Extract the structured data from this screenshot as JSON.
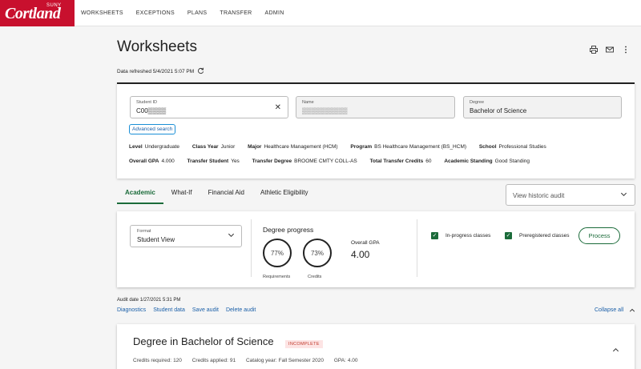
{
  "brand": {
    "suny": "SUNY",
    "name": "Cortland"
  },
  "nav": [
    "WORKSHEETS",
    "EXCEPTIONS",
    "PLANS",
    "TRANSFER",
    "ADMIN"
  ],
  "page_title": "Worksheets",
  "icons": {
    "print": "print-icon",
    "mail": "mail-icon",
    "more": "more-vertical-icon",
    "refresh": "refresh-icon"
  },
  "refresh_text": "Data refreshed 5/4/2021 5:07 PM",
  "student": {
    "id_label": "Student ID",
    "id_value": "C00▒▒▒▒",
    "name_label": "Name",
    "name_value": "▒▒▒▒▒▒▒▒▒▒",
    "degree_label": "Degree",
    "degree_value": "Bachelor of Science",
    "advanced_search": "Advanced search",
    "row1": [
      {
        "k": "Level",
        "v": "Undergraduate"
      },
      {
        "k": "Class Year",
        "v": "Junior"
      },
      {
        "k": "Major",
        "v": "Healthcare Management (HCM)"
      },
      {
        "k": "Program",
        "v": "BS Healthcare Management (BS_HCM)"
      },
      {
        "k": "School",
        "v": "Professional Studies"
      }
    ],
    "row2": [
      {
        "k": "Overall GPA",
        "v": "4.000"
      },
      {
        "k": "Transfer Student",
        "v": "Yes"
      },
      {
        "k": "Transfer Degree",
        "v": "BROOME CMTY COLL-AS"
      },
      {
        "k": "Total Transfer Credits",
        "v": "60"
      },
      {
        "k": "Academic Standing",
        "v": "Good Standing"
      }
    ]
  },
  "tabs": [
    "Academic",
    "What-If",
    "Financial Aid",
    "Athletic Eligibility"
  ],
  "historic_audit": "View historic audit",
  "progress": {
    "format_label": "Format",
    "format_value": "Student View",
    "title": "Degree progress",
    "requirements_pct": "77%",
    "requirements_label": "Requirements",
    "requirements_value": 0.77,
    "credits_pct": "73%",
    "credits_label": "Credits",
    "credits_value": 0.73,
    "gpa_label": "Overall GPA",
    "gpa_value": "4.00",
    "inprogress_label": "In-progress classes",
    "prereg_label": "Preregistered classes",
    "process_label": "Process",
    "accent": "#1b6b3a"
  },
  "audit_date": "Audit date 1/27/2021 5:31 PM",
  "links": [
    "Diagnostics",
    "Student data",
    "Save audit",
    "Delete audit"
  ],
  "collapse_all": "Collapse all",
  "degree": {
    "title": "Degree in Bachelor of Science",
    "status": "INCOMPLETE",
    "meta": [
      {
        "k": "Credits required:",
        "v": "120"
      },
      {
        "k": "Credits applied:",
        "v": "91"
      },
      {
        "k": "Catalog year:",
        "v": "Fall Semester 2020"
      },
      {
        "k": "GPA:",
        "v": "4.00"
      }
    ]
  }
}
